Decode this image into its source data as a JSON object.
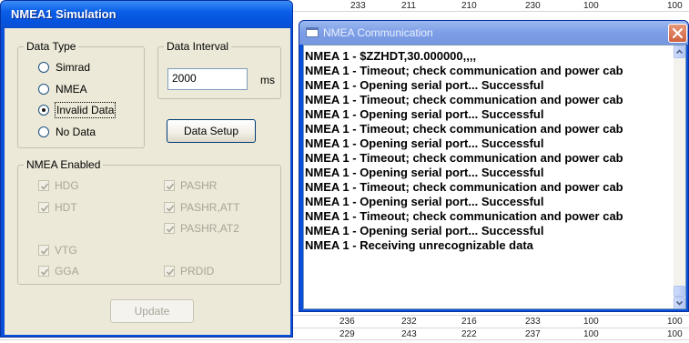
{
  "background_table": {
    "rows": [
      [
        "233",
        "211",
        "210",
        "230",
        "100",
        "100"
      ],
      [
        "236",
        "232",
        "216",
        "233",
        "100",
        "100"
      ],
      [
        "229",
        "243",
        "222",
        "237",
        "100",
        "100"
      ]
    ]
  },
  "sim_window": {
    "title": "NMEA1 Simulation",
    "data_type": {
      "legend": "Data Type",
      "options": [
        {
          "label": "Simrad",
          "selected": false
        },
        {
          "label": "NMEA",
          "selected": false
        },
        {
          "label": "Invalid Data",
          "selected": true
        },
        {
          "label": "No Data",
          "selected": false
        }
      ]
    },
    "data_interval": {
      "legend": "Data Interval",
      "value": "2000",
      "unit": "ms"
    },
    "data_setup_label": "Data Setup",
    "nmea_enabled": {
      "legend": "NMEA Enabled",
      "checks": {
        "hdg": {
          "label": "HDG",
          "checked": true
        },
        "hdt": {
          "label": "HDT",
          "checked": true
        },
        "vtg": {
          "label": "VTG",
          "checked": true
        },
        "gga": {
          "label": "GGA",
          "checked": true
        },
        "pashr": {
          "label": "PASHR",
          "checked": true
        },
        "pashr_att": {
          "label": "PASHR,ATT",
          "checked": true
        },
        "pashr_at2": {
          "label": "PASHR,AT2",
          "checked": true
        },
        "prdid": {
          "label": "PRDID",
          "checked": true
        }
      }
    },
    "update_label": "Update"
  },
  "comm_window": {
    "title": "NMEA Communication",
    "log": [
      "NMEA 1 - $ZZHDT,30.000000,,,,",
      "NMEA 1 - Timeout; check communication and power cab",
      "NMEA 1 - Opening serial port... Successful",
      "NMEA 1 - Timeout; check communication and power cab",
      "NMEA 1 - Opening serial port... Successful",
      "NMEA 1 - Timeout; check communication and power cab",
      "NMEA 1 - Opening serial port... Successful",
      "NMEA 1 - Timeout; check communication and power cab",
      "NMEA 1 - Opening serial port... Successful",
      "NMEA 1 - Timeout; check communication and power cab",
      "NMEA 1 - Opening serial port... Successful",
      "NMEA 1 - Timeout; check communication and power cab",
      "NMEA 1 - Opening serial port... Successful",
      "NMEA 1 - Receiving unrecognizable data"
    ]
  },
  "colors": {
    "xp_title_active": "#0a5ee8",
    "xp_title_inactive": "#7d9ee6",
    "dialog_face": "#ece9d8",
    "disabled_text": "#a8a598"
  }
}
